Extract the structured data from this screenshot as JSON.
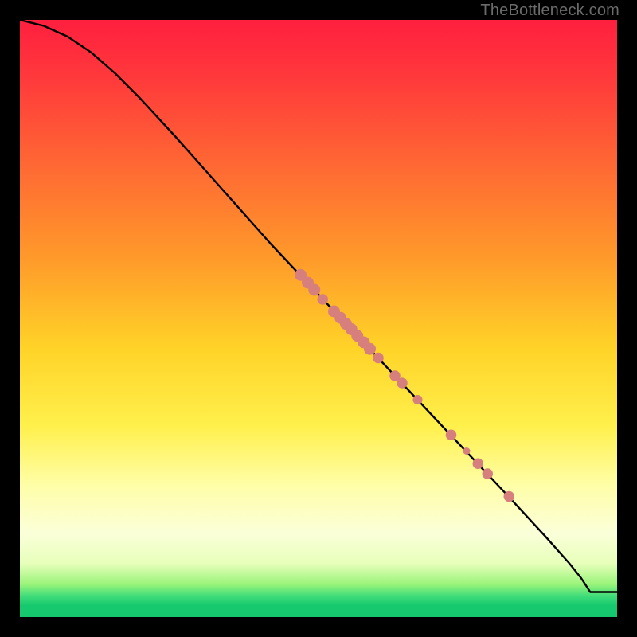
{
  "watermark": "TheBottleneck.com",
  "colors": {
    "curve": "#000000",
    "dot_fill": "#d77f7d",
    "dot_stroke": "#c06866"
  },
  "chart_data": {
    "type": "line",
    "title": "",
    "xlabel": "",
    "ylabel": "",
    "xlim": [
      0,
      100
    ],
    "ylim": [
      0,
      100
    ],
    "series": [
      {
        "name": "curve",
        "x": [
          0,
          4,
          8,
          12,
          16,
          20,
          26,
          34,
          42,
          50,
          58,
          66,
          74,
          82,
          88,
          92,
          94,
          95.5,
          100
        ],
        "y": [
          100,
          99,
          97.2,
          94.5,
          91,
          87,
          80.5,
          71.5,
          62.5,
          54,
          45.5,
          37,
          28.5,
          20,
          13.5,
          9,
          6.5,
          4.2,
          4.2
        ]
      }
    ],
    "dots": [
      {
        "x": 47.0,
        "y": 57.3,
        "r": 1.0
      },
      {
        "x": 48.2,
        "y": 56.0,
        "r": 1.0
      },
      {
        "x": 49.3,
        "y": 54.8,
        "r": 1.0
      },
      {
        "x": 50.7,
        "y": 53.2,
        "r": 0.9
      },
      {
        "x": 52.6,
        "y": 51.2,
        "r": 1.0
      },
      {
        "x": 53.7,
        "y": 50.1,
        "r": 1.0
      },
      {
        "x": 54.6,
        "y": 49.1,
        "r": 1.0
      },
      {
        "x": 55.5,
        "y": 48.2,
        "r": 1.0
      },
      {
        "x": 56.5,
        "y": 47.1,
        "r": 1.0
      },
      {
        "x": 57.6,
        "y": 46.0,
        "r": 1.0
      },
      {
        "x": 58.6,
        "y": 44.9,
        "r": 1.0
      },
      {
        "x": 60.0,
        "y": 43.4,
        "r": 0.9
      },
      {
        "x": 62.8,
        "y": 40.4,
        "r": 0.9
      },
      {
        "x": 64.0,
        "y": 39.2,
        "r": 0.9
      },
      {
        "x": 66.6,
        "y": 36.4,
        "r": 0.8
      },
      {
        "x": 72.2,
        "y": 30.5,
        "r": 0.9
      },
      {
        "x": 74.8,
        "y": 27.8,
        "r": 0.6
      },
      {
        "x": 76.7,
        "y": 25.7,
        "r": 0.9
      },
      {
        "x": 78.3,
        "y": 24.0,
        "r": 0.9
      },
      {
        "x": 81.9,
        "y": 20.2,
        "r": 0.9
      }
    ]
  }
}
